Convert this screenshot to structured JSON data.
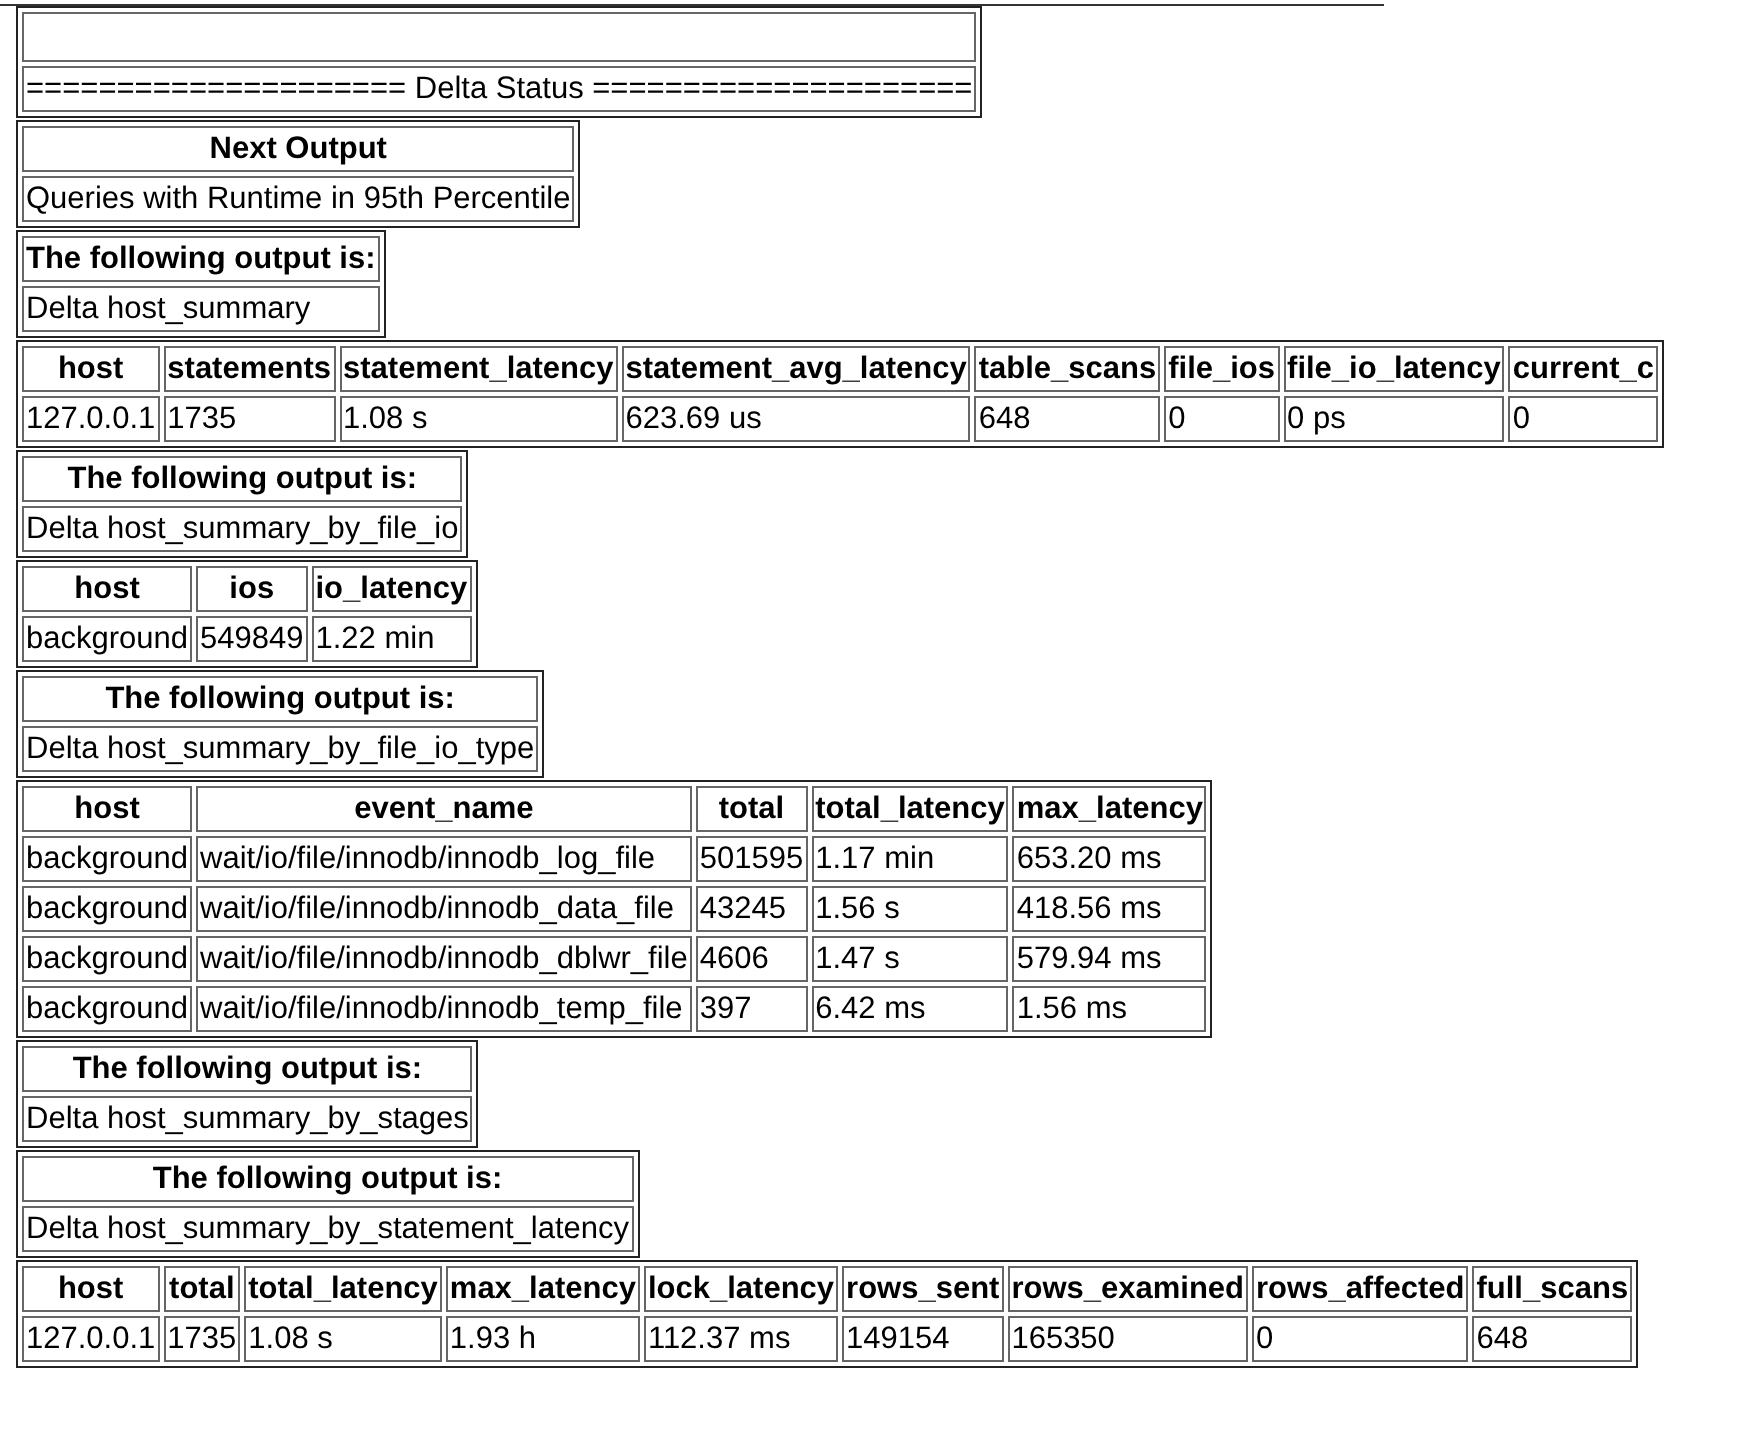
{
  "banner": {
    "title": "===================== Delta Status ====================="
  },
  "blocks": [
    {
      "kind": "caption",
      "header": "Next Output",
      "value": "Queries with Runtime in 95th Percentile"
    },
    {
      "kind": "caption",
      "header": "The following output is:",
      "value": "Delta host_summary"
    },
    {
      "kind": "table",
      "columns": [
        "host",
        "statements",
        "statement_latency",
        "statement_avg_latency",
        "table_scans",
        "file_ios",
        "file_io_latency",
        "current_c"
      ],
      "rows": [
        [
          "127.0.0.1",
          "1735",
          "1.08 s",
          "623.69 us",
          "648",
          "0",
          "0 ps",
          "0"
        ]
      ]
    },
    {
      "kind": "caption",
      "header": "The following output is:",
      "value": "Delta host_summary_by_file_io"
    },
    {
      "kind": "table",
      "columns": [
        "host",
        "ios",
        "io_latency"
      ],
      "rows": [
        [
          "background",
          "549849",
          "1.22 min"
        ]
      ]
    },
    {
      "kind": "caption",
      "header": "The following output is:",
      "value": "Delta host_summary_by_file_io_type"
    },
    {
      "kind": "table",
      "columns": [
        "host",
        "event_name",
        "total",
        "total_latency",
        "max_latency"
      ],
      "rows": [
        [
          "background",
          "wait/io/file/innodb/innodb_log_file",
          "501595",
          "1.17 min",
          "653.20 ms"
        ],
        [
          "background",
          "wait/io/file/innodb/innodb_data_file",
          "43245",
          "1.56 s",
          "418.56 ms"
        ],
        [
          "background",
          "wait/io/file/innodb/innodb_dblwr_file",
          "4606",
          "1.47 s",
          "579.94 ms"
        ],
        [
          "background",
          "wait/io/file/innodb/innodb_temp_file",
          "397",
          "6.42 ms",
          "1.56 ms"
        ]
      ]
    },
    {
      "kind": "caption",
      "header": "The following output is:",
      "value": "Delta host_summary_by_stages"
    },
    {
      "kind": "caption",
      "header": "The following output is:",
      "value": "Delta host_summary_by_statement_latency"
    },
    {
      "kind": "table",
      "columns": [
        "host",
        "total",
        "total_latency",
        "max_latency",
        "lock_latency",
        "rows_sent",
        "rows_examined",
        "rows_affected",
        "full_scans"
      ],
      "rows": [
        [
          "127.0.0.1",
          "1735",
          "1.08 s",
          "1.93 h",
          "112.37 ms",
          "149154",
          "165350",
          "0",
          "648"
        ]
      ]
    }
  ]
}
